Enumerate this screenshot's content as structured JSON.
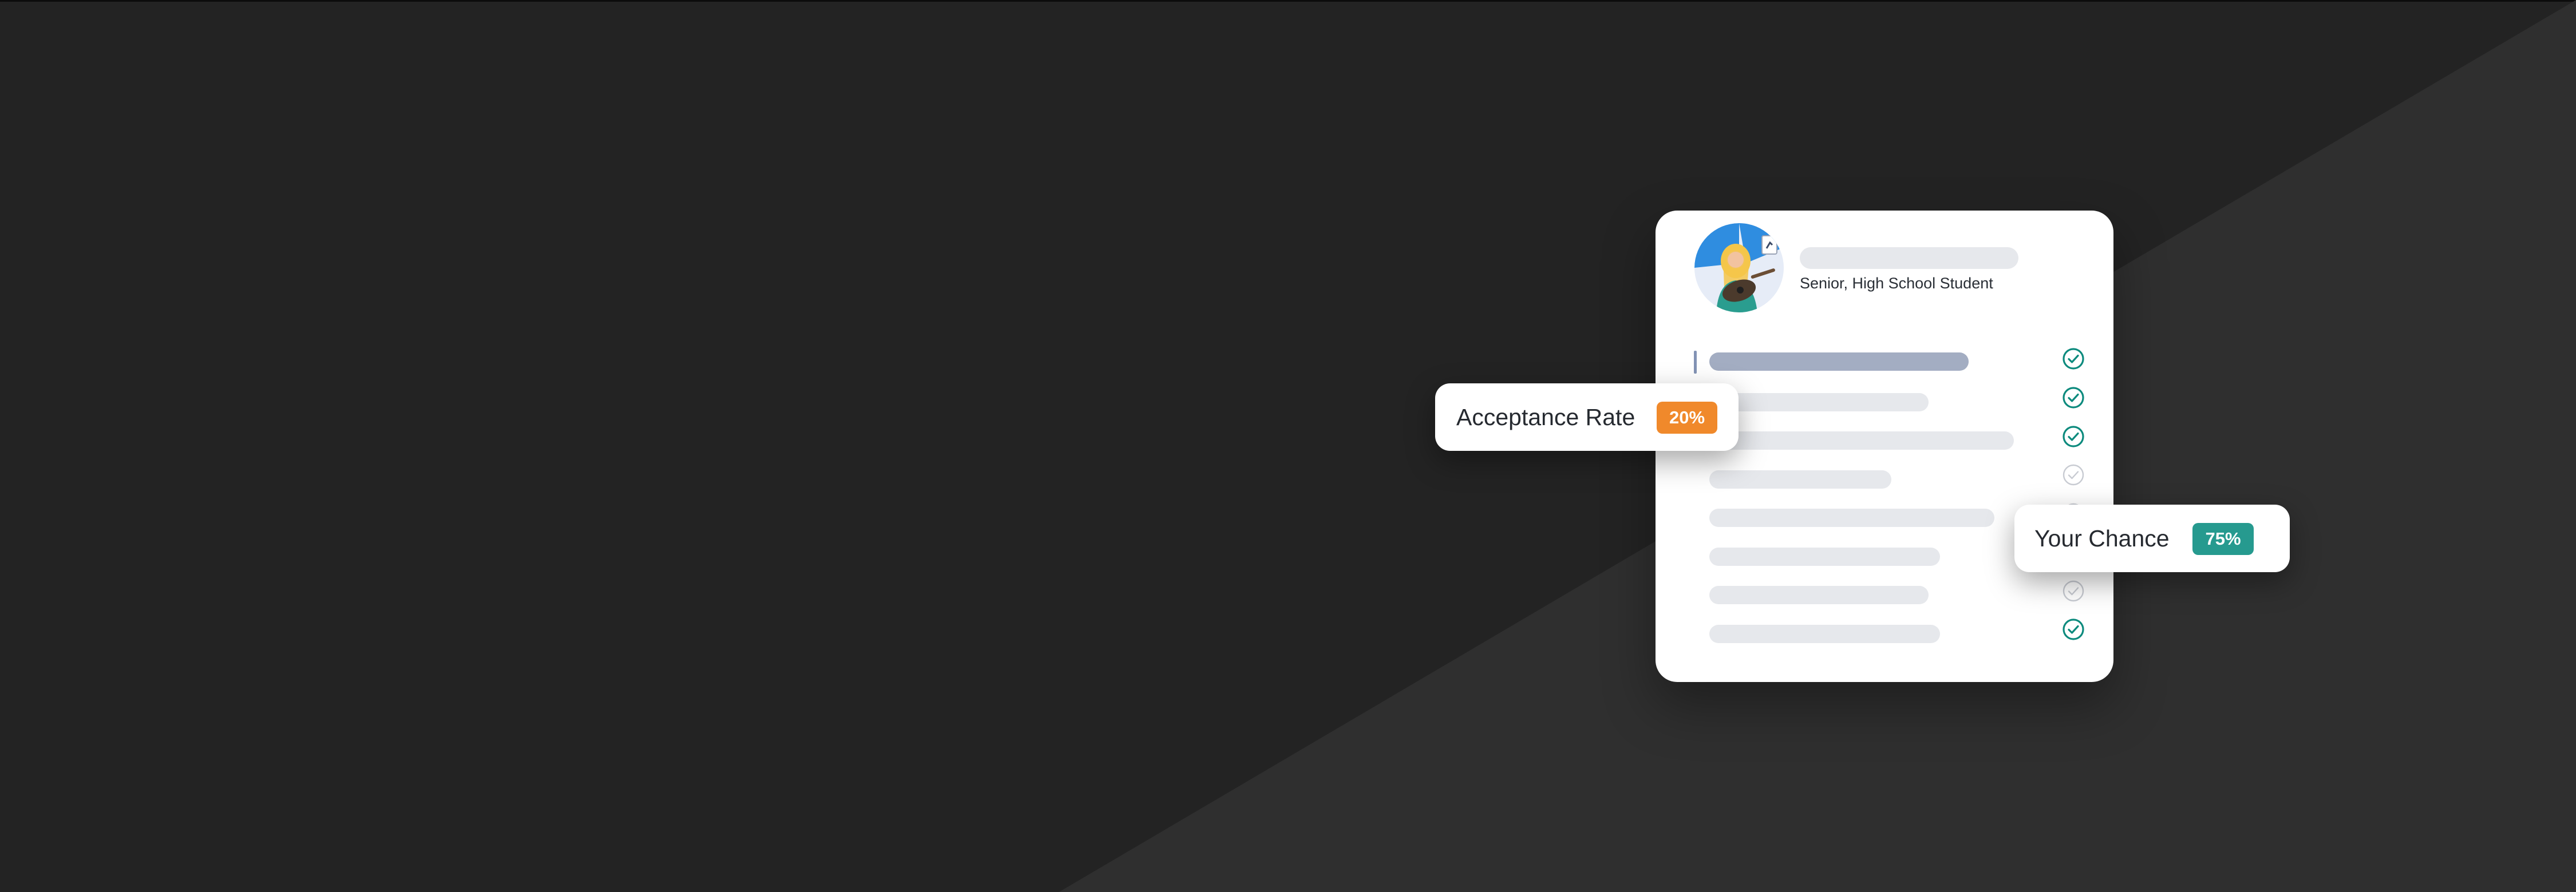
{
  "colors": {
    "background": "#232323",
    "background_wedge": "#2f2f2f",
    "card": "#ffffff",
    "placeholder_bar": "#e6e8ec",
    "placeholder_bar_active": "#a3adc2",
    "check_done": "#0c8a7d",
    "check_pending": "#c8cbd2",
    "acceptance_badge": "#f0892b",
    "chance_badge": "#269a8f"
  },
  "profile": {
    "subtitle": "Senior, High School Student",
    "avatar_icon": "student-with-guitar-avatar"
  },
  "checklist": {
    "items": [
      {
        "state": "done",
        "active": true
      },
      {
        "state": "done",
        "active": false
      },
      {
        "state": "done",
        "active": false
      },
      {
        "state": "pending",
        "active": false
      },
      {
        "state": "pending",
        "active": false
      },
      {
        "state": "pending",
        "active": false
      },
      {
        "state": "pending",
        "active": false
      },
      {
        "state": "done",
        "active": false
      }
    ]
  },
  "acceptance": {
    "label": "Acceptance Rate",
    "badge": "20%",
    "value_percent": 20
  },
  "chance": {
    "label": "Your Chance",
    "badge": "75%",
    "value_percent": 75
  }
}
